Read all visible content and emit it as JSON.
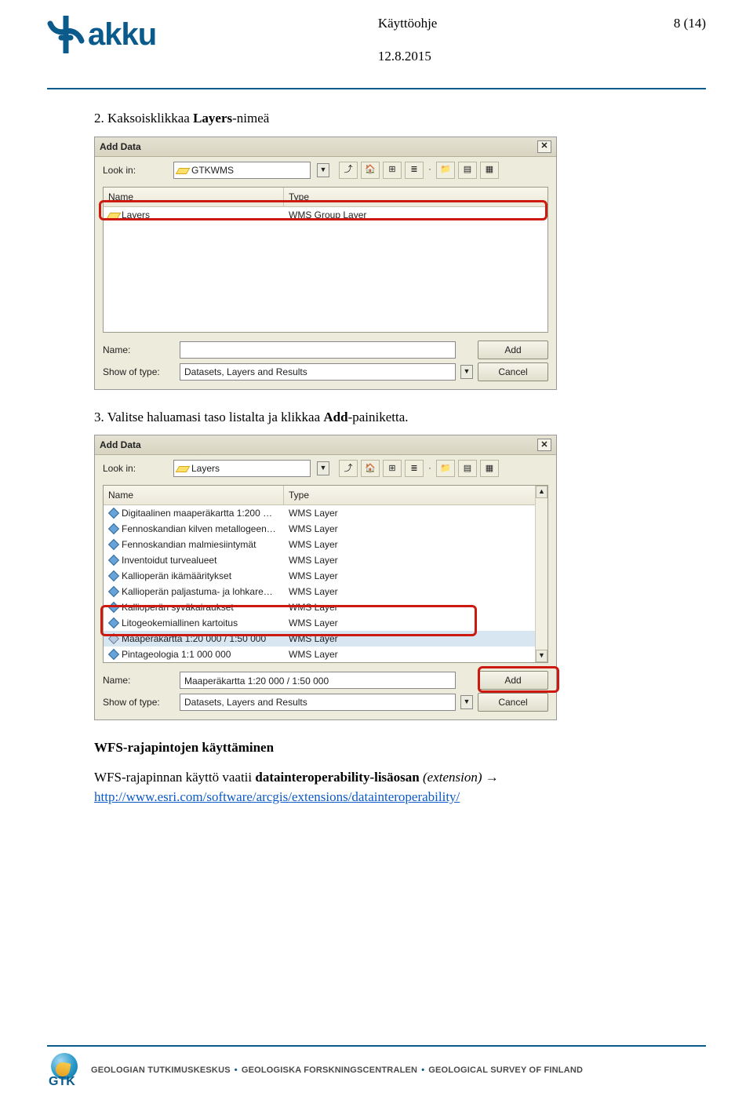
{
  "header": {
    "brand": "akku",
    "doc_type": "Käyttöohje",
    "date": "12.8.2015",
    "page": "8 (14)"
  },
  "step2": {
    "num": "2.",
    "pre": " Kaksoisklikkaa ",
    "bold": "Layers",
    "post": "-nimeä"
  },
  "step3": {
    "num": "3.",
    "pre": " Valitse haluamasi taso listalta ja klikkaa ",
    "bold": "Add",
    "post": "-painiketta."
  },
  "dialogA": {
    "title": "Add Data",
    "lookin_label": "Look in:",
    "lookin_value": "GTKWMS",
    "col_name": "Name",
    "col_type": "Type",
    "row_name": "Layers",
    "row_type": "WMS Group Layer",
    "name_label": "Name:",
    "name_value": "",
    "show_label": "Show of type:",
    "show_value": "Datasets, Layers and Results",
    "btn_add": "Add",
    "btn_cancel": "Cancel"
  },
  "dialogB": {
    "title": "Add Data",
    "lookin_label": "Look in:",
    "lookin_value": "Layers",
    "col_name": "Name",
    "col_type": "Type",
    "rows": [
      {
        "n": "Digitaalinen maaperäkartta 1:200 …",
        "t": "WMS Layer",
        "sel": false
      },
      {
        "n": "Fennoskandian kilven metallogeen…",
        "t": "WMS Layer",
        "sel": false
      },
      {
        "n": "Fennoskandian malmiesiintymät",
        "t": "WMS Layer",
        "sel": false
      },
      {
        "n": "Inventoidut turvealueet",
        "t": "WMS Layer",
        "sel": false
      },
      {
        "n": "Kallioperän ikämääritykset",
        "t": "WMS Layer",
        "sel": false
      },
      {
        "n": "Kallioperän paljastuma- ja lohkare…",
        "t": "WMS Layer",
        "sel": false
      },
      {
        "n": "Kallioperän syväkairaukset",
        "t": "WMS Layer",
        "sel": false
      },
      {
        "n": "Litogeokemiallinen kartoitus",
        "t": "WMS Layer",
        "sel": false
      },
      {
        "n": "Maaperäkartta 1:20 000 / 1:50 000",
        "t": "WMS Layer",
        "sel": true
      },
      {
        "n": "Pintageologia 1:1 000 000",
        "t": "WMS Layer",
        "sel": false
      }
    ],
    "name_label": "Name:",
    "name_value": "Maaperäkartta 1:20 000 / 1:50 000",
    "show_label": "Show of type:",
    "show_value": "Datasets, Layers and Results",
    "btn_add": "Add",
    "btn_cancel": "Cancel"
  },
  "wfs": {
    "heading": "WFS-rajapintojen käyttäminen",
    "text_pre": "WFS-rajapinnan käyttö vaatii ",
    "text_bold": "datainteroperability-lisäosan",
    "text_em": " (extension)",
    "arrow": " → ",
    "link": "http://www.esri.com/software/arcgis/extensions/datainteroperability/"
  },
  "footer": {
    "gtk": "GTK",
    "org_fi": "GEOLOGIAN TUTKIMUSKESKUS",
    "org_sv": "GEOLOGISKA FORSKNINGSCENTRALEN",
    "org_en": "GEOLOGICAL SURVEY OF FINLAND"
  }
}
